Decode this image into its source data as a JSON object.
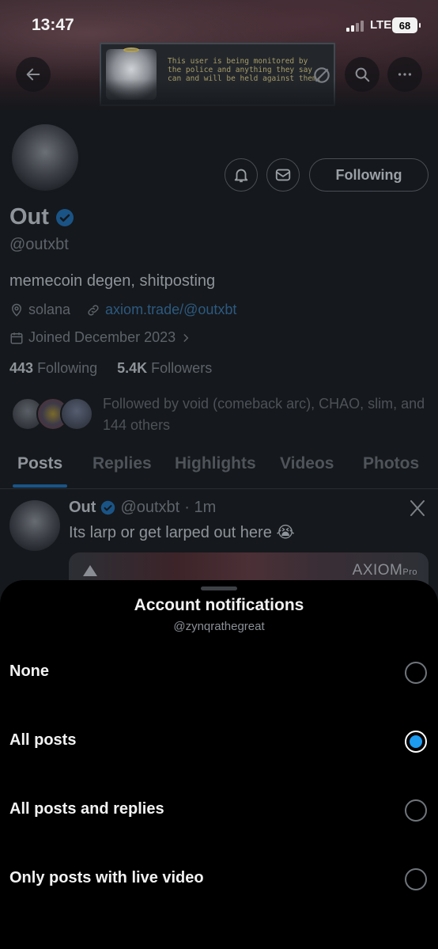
{
  "status_bar": {
    "time": "13:47",
    "network": "LTE",
    "battery": "68"
  },
  "banner": {
    "monitor_text": "This user is being monitored by the police and anything they say can and will be held against them."
  },
  "profile": {
    "following_button": "Following",
    "name": "Out",
    "handle": "@outxbt",
    "bio": "memecoin degen, shitposting",
    "location": "solana",
    "link": "axiom.trade/@outxbt",
    "joined": "Joined December 2023",
    "following_count": "443",
    "following_label": "Following",
    "followers_count": "5.4K",
    "followers_label": "Followers",
    "followed_by": "Followed by void (comeback arc), CHAO, slim, and 144 others"
  },
  "tabs": [
    "Posts",
    "Replies",
    "Highlights",
    "Videos",
    "Photos"
  ],
  "post": {
    "name": "Out",
    "handle": "@outxbt",
    "time": "· 1m",
    "text": "Its larp or get larped out here 😭",
    "media_brand": "AXIOM",
    "media_brand_sub": "Pro"
  },
  "sheet": {
    "title": "Account notifications",
    "subtitle": "@zynqrathegreat",
    "options": [
      {
        "label": "None",
        "selected": false
      },
      {
        "label": "All posts",
        "selected": true
      },
      {
        "label": "All posts and replies",
        "selected": false
      },
      {
        "label": "Only posts with live video",
        "selected": false
      }
    ]
  },
  "colors": {
    "accent": "#1d9bf0",
    "sheet_bg": "#000000",
    "dimmed_bg": "#15181c"
  }
}
